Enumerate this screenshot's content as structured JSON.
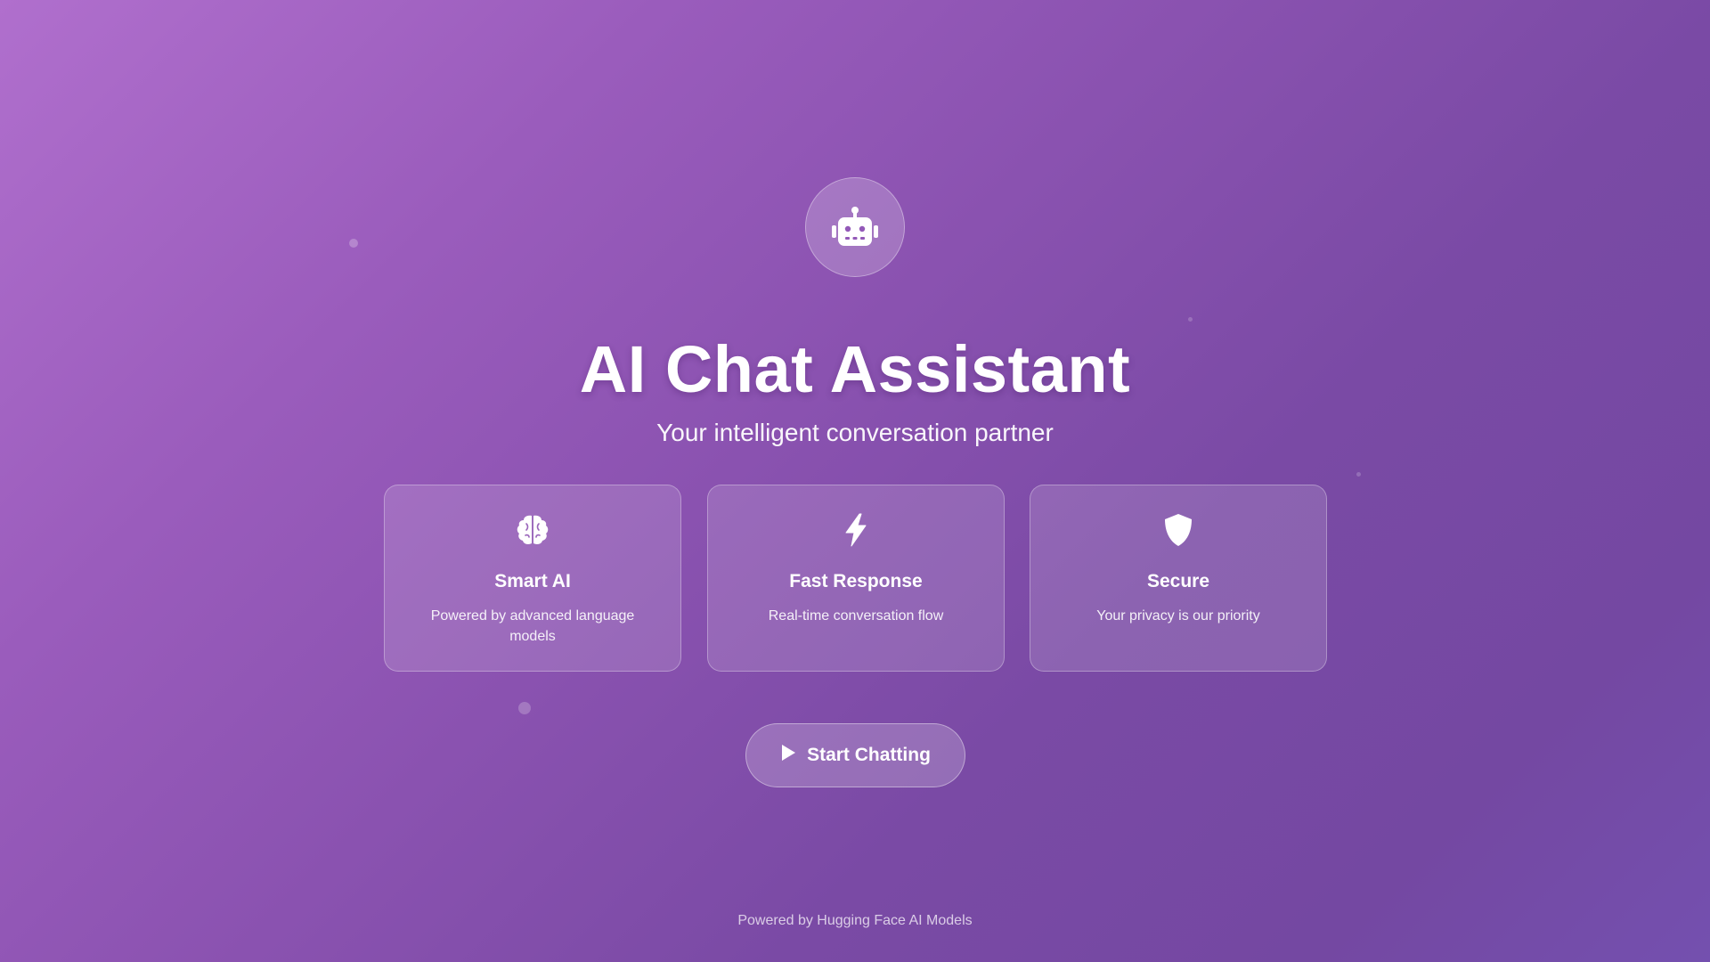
{
  "hero": {
    "icon": "robot-icon",
    "title": "AI Chat Assistant",
    "subtitle": "Your intelligent conversation partner"
  },
  "features": [
    {
      "icon": "brain-icon",
      "title": "Smart AI",
      "description": "Powered by advanced language models"
    },
    {
      "icon": "lightning-bolt-icon",
      "title": "Fast Response",
      "description": "Real-time conversation flow"
    },
    {
      "icon": "shield-icon",
      "title": "Secure",
      "description": "Your privacy is our priority"
    }
  ],
  "cta": {
    "icon": "play-icon",
    "label": "Start Chatting"
  },
  "footer": {
    "text": "Powered by Hugging Face AI Models"
  },
  "colors": {
    "background_start": "#b06fcd",
    "background_end": "#7450af",
    "text": "#ffffff"
  }
}
